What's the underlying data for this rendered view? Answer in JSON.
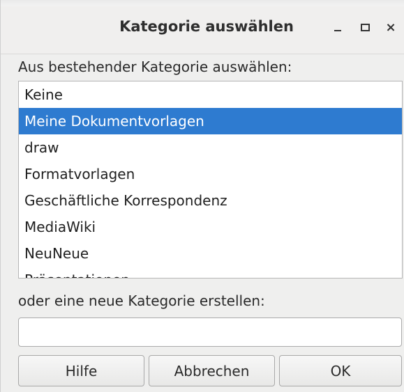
{
  "window": {
    "title": "Kategorie auswählen",
    "controls": {
      "minimize_icon": "minimize-icon",
      "maximize_icon": "maximize-icon",
      "close_glyph": "×"
    }
  },
  "existing": {
    "label": "Aus bestehender Kategorie auswählen:",
    "selected_color": "#2e7bd0",
    "items": [
      {
        "label": "Keine",
        "selected": false
      },
      {
        "label": "Meine Dokumentvorlagen",
        "selected": true
      },
      {
        "label": "draw",
        "selected": false
      },
      {
        "label": "Formatvorlagen",
        "selected": false
      },
      {
        "label": "Geschäftliche Korrespondenz",
        "selected": false
      },
      {
        "label": "MediaWiki",
        "selected": false
      },
      {
        "label": "NeuNeue",
        "selected": false
      },
      {
        "label": "Präsentationen",
        "selected": false
      }
    ]
  },
  "new_category": {
    "label": "oder eine neue Kategorie erstellen:",
    "value": ""
  },
  "buttons": {
    "help": "Hilfe",
    "cancel": "Abbrechen",
    "ok": "OK"
  }
}
